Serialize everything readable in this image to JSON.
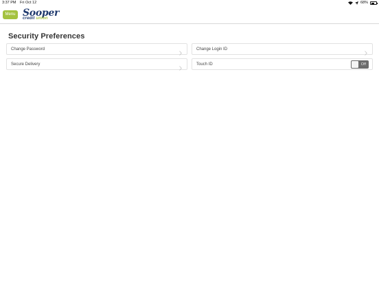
{
  "status_bar": {
    "time": "3:37 PM",
    "date": "Fri Oct 12",
    "battery": "68%",
    "battery_level": 0.68,
    "icons": [
      "wifi-icon",
      "location-icon",
      "battery-icon"
    ]
  },
  "header": {
    "menu_label": "Menu",
    "logo": {
      "top": "Sooper",
      "bottom_a": "credit ",
      "bottom_b": "union"
    }
  },
  "page": {
    "title": "Security Preferences",
    "items": [
      {
        "label": "Change Password",
        "control": "chevron"
      },
      {
        "label": "Change Login ID",
        "control": "chevron"
      },
      {
        "label": "Secure Delivery",
        "control": "chevron"
      },
      {
        "label": "Touch ID",
        "control": "toggle",
        "toggle_label": "Off"
      }
    ]
  },
  "colors": {
    "accent": "#a4c23f",
    "brand": "#1f3a6e",
    "toggle_off": "#6b6b6b",
    "border": "#e2e2e2"
  }
}
